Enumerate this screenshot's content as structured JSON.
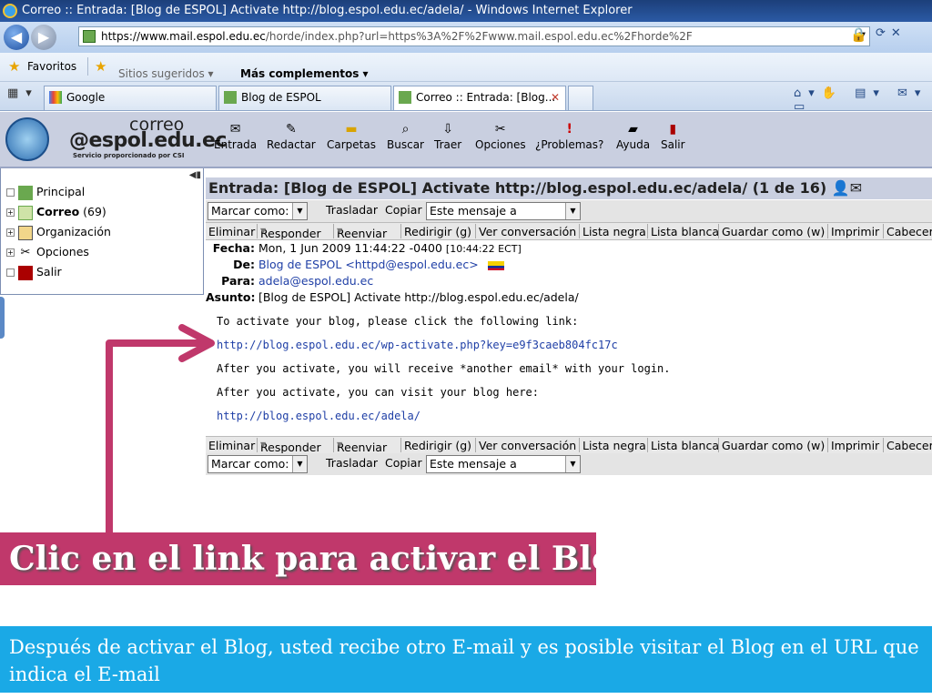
{
  "window": {
    "title": "Correo :: Entrada: [Blog de ESPOL] Activate http://blog.espol.edu.ec/adela/ - Windows Internet Explorer"
  },
  "address": {
    "url_host": "https://www.mail.espol.edu.ec",
    "url_rest": "/horde/index.php?url=https%3A%2F%2Fwww.mail.espol.edu.ec%2Fhorde%2F"
  },
  "favorites": {
    "favoritos": "Favoritos",
    "sitios": "Sitios sugeridos ▾",
    "complementos": "Más complementos ▾"
  },
  "tabs": [
    {
      "label": "Google"
    },
    {
      "label": "Blog de ESPOL"
    },
    {
      "label": "Correo :: Entrada: [Blog..."
    }
  ],
  "logo": {
    "line1": "correo",
    "line2": "@espol.edu.ec",
    "line3": "Servicio proporcionado por CSI"
  },
  "toolbar": [
    {
      "label": "Entrada",
      "icon": "envelope-icon"
    },
    {
      "label": "Redactar",
      "icon": "compose-icon"
    },
    {
      "label": "Carpetas",
      "icon": "folder-icon"
    },
    {
      "label": "Buscar",
      "icon": "search-icon"
    },
    {
      "label": "Traer",
      "icon": "fetch-icon"
    },
    {
      "label": "Opciones",
      "icon": "tools-icon"
    },
    {
      "label": "¿Problemas?",
      "icon": "exclamation-icon"
    },
    {
      "label": "Ayuda",
      "icon": "help-book-icon"
    },
    {
      "label": "Salir",
      "icon": "exit-door-icon"
    }
  ],
  "sidebar": {
    "items": [
      {
        "label": "Principal"
      },
      {
        "label": "Correo",
        "count": "(69)"
      },
      {
        "label": "Organización"
      },
      {
        "label": "Opciones"
      },
      {
        "label": "Salir"
      }
    ]
  },
  "message": {
    "title": "Entrada: [Blog de ESPOL] Activate http://blog.espol.edu.ec/adela/ (1 de 16)",
    "marcar": "Marcar como:",
    "trasladar": "Trasladar",
    "copiar": "Copiar",
    "este_mensaje": "Este mensaje a",
    "actions": [
      "Eliminar",
      "Responder",
      "Reenviar",
      "Redirigir (g)",
      "Ver conversación",
      "Lista negra",
      "Lista blanca",
      "Guardar como (w)",
      "Imprimir",
      "Cabecer"
    ],
    "fecha_label": "Fecha:",
    "fecha_value": "Mon, 1 Jun 2009 11:44:22 -0400",
    "fecha_local": "[10:44:22 ECT]",
    "de_label": "De:",
    "de_value": "Blog de ESPOL <httpd@espol.edu.ec>",
    "para_label": "Para:",
    "para_value": "adela@espol.edu.ec",
    "asunto_label": "Asunto:",
    "asunto_value": "[Blog de ESPOL] Activate http://blog.espol.edu.ec/adela/",
    "body": {
      "line1": "To activate your blog, please click the following link:",
      "link1": "http://blog.espol.edu.ec/wp-activate.php?key=e9f3caeb804fc17c",
      "line2": "After you activate, you will receive *another email* with your login.",
      "line3": "After you activate, you can visit your blog here:",
      "link2": "http://blog.espol.edu.ec/adela/"
    }
  },
  "annotation": {
    "caption": "Clic en el link para activar el Blog",
    "info": "Después de activar el Blog, usted recibe otro E-mail y es posible visitar el Blog en el URL que indica el E-mail",
    "arrow_color": "#c0386b",
    "caption_bg": "#c0386b",
    "info_bg": "#1aa9e6"
  }
}
